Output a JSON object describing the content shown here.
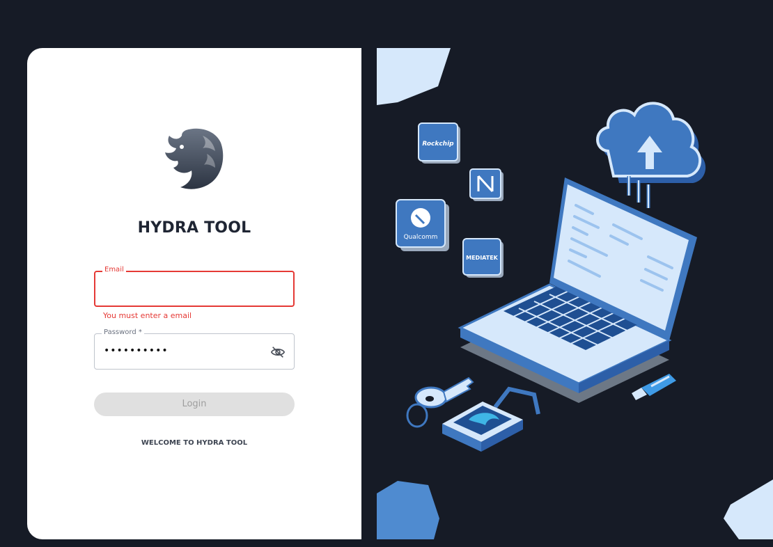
{
  "app": {
    "title": "HYDRA TOOL",
    "welcome": "WELCOME TO HYDRA TOOL"
  },
  "form": {
    "email": {
      "label": "Email",
      "value": "",
      "error": "You must enter a email"
    },
    "password": {
      "label": "Password *",
      "value": "••••••••••"
    },
    "login_label": "Login"
  },
  "illustration": {
    "chips": [
      "Rockchip",
      "Qualcomm",
      "MEDIATEK"
    ]
  },
  "colors": {
    "background": "#161b26",
    "accent_blue": "#3f78c0",
    "light_blue": "#d6e8fb",
    "error": "#e53935",
    "disabled": "#e0e0e0"
  },
  "icons": [
    "hydra-logo-icon",
    "eye-slash-icon",
    "cloud-upload-icon",
    "laptop-icon",
    "key-icon",
    "padlock-icon",
    "usb-drive-icon"
  ]
}
